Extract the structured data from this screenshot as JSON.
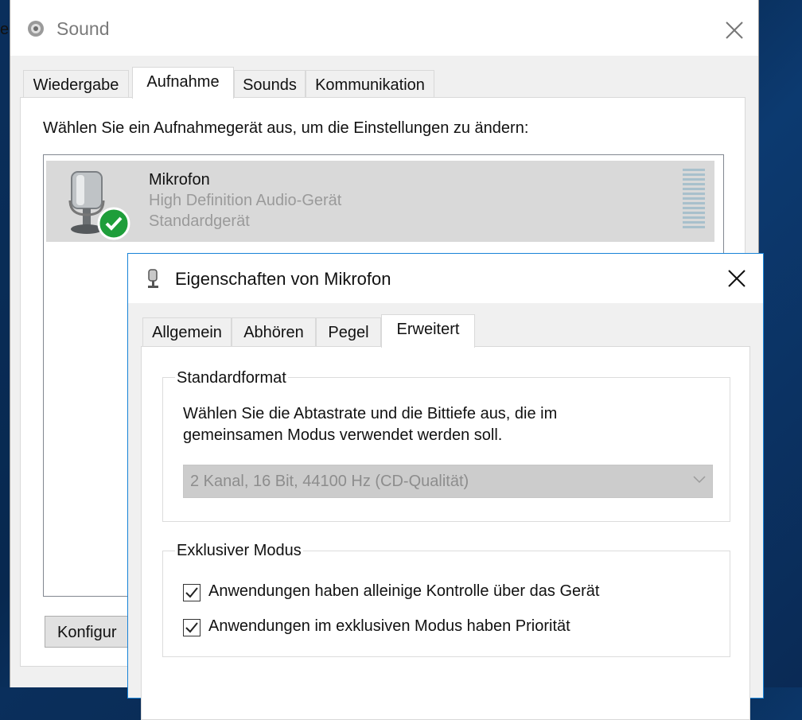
{
  "background_edge_text": "e",
  "sound_window": {
    "title": "Sound",
    "tabs": [
      {
        "label": "Wiedergabe"
      },
      {
        "label": "Aufnahme",
        "active": true
      },
      {
        "label": "Sounds"
      },
      {
        "label": "Kommunikation"
      }
    ],
    "description": "Wählen Sie ein Aufnahmegerät aus, um die Einstellungen zu ändern:",
    "device": {
      "name": "Mikrofon",
      "driver": "High Definition Audio-Gerät",
      "status": "Standardgerät"
    },
    "configure_button": "Konfigur"
  },
  "properties_dialog": {
    "title": "Eigenschaften von Mikrofon",
    "tabs": [
      {
        "label": "Allgemein"
      },
      {
        "label": "Abhören"
      },
      {
        "label": "Pegel"
      },
      {
        "label": "Erweitert",
        "active": true
      }
    ],
    "default_format": {
      "group_label": "Standardformat",
      "description_line1": "Wählen Sie die Abtastrate und die Bittiefe aus, die im",
      "description_line2": "gemeinsamen Modus verwendet werden soll.",
      "selected_value": "2 Kanal, 16 Bit, 44100 Hz (CD-Qualität)"
    },
    "exclusive_mode": {
      "group_label": "Exklusiver Modus",
      "options": [
        {
          "label": "Anwendungen haben alleinige Kontrolle über das Gerät",
          "checked": true
        },
        {
          "label": "Anwendungen im exklusiven Modus haben Priorität",
          "checked": true
        }
      ]
    }
  },
  "colors": {
    "accent_border": "#1883d7",
    "check_green": "#1e9e3a",
    "selection_bg": "#d9d9d9"
  }
}
